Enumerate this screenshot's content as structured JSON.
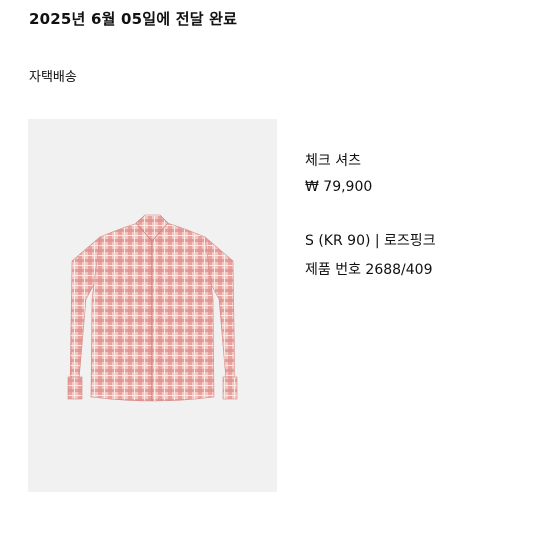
{
  "order": {
    "delivery_status": "2025년 6월 05일에 전달 완료",
    "delivery_method": "자택배송"
  },
  "item": {
    "name": "체크 셔츠",
    "price": "₩ 79,900",
    "option": "S (KR 90) | 로즈핑크",
    "product_number": "제품 번호 2688/409"
  }
}
